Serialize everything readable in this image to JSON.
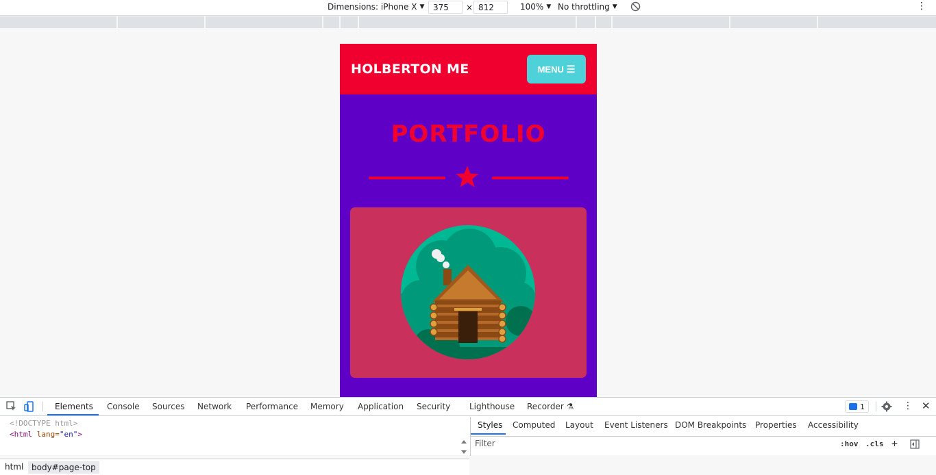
{
  "device_toolbar": {
    "dimensions_label": "Dimensions: iPhone X",
    "width": "375",
    "times": "×",
    "height": "812",
    "zoom": "100%",
    "throttling": "No throttling"
  },
  "page": {
    "brand": "HOLBERTON ME",
    "menu_label": "MENU",
    "title": "PORTFOLIO"
  },
  "colors": {
    "header_red": "#f0002e",
    "page_purple": "#5f00c7",
    "menu_teal": "#4fd1d9",
    "card_pink": "#c9305b"
  },
  "devtools": {
    "tabs": [
      "Elements",
      "Console",
      "Sources",
      "Network",
      "Performance",
      "Memory",
      "Application",
      "Security",
      "Lighthouse",
      "Recorder"
    ],
    "issues_count": "1",
    "code_doctype": "<!DOCTYPE html>",
    "code_html_tag": "<html",
    "code_html_attr": " lang=",
    "code_html_val": "\"en\"",
    "code_html_close": ">",
    "breadcrumb": [
      "html",
      "body#page-top"
    ],
    "styles_tabs": [
      "Styles",
      "Computed",
      "Layout",
      "Event Listeners",
      "DOM Breakpoints",
      "Properties",
      "Accessibility"
    ],
    "filter_placeholder": "Filter",
    "hov": ":hov",
    "cls": ".cls"
  }
}
